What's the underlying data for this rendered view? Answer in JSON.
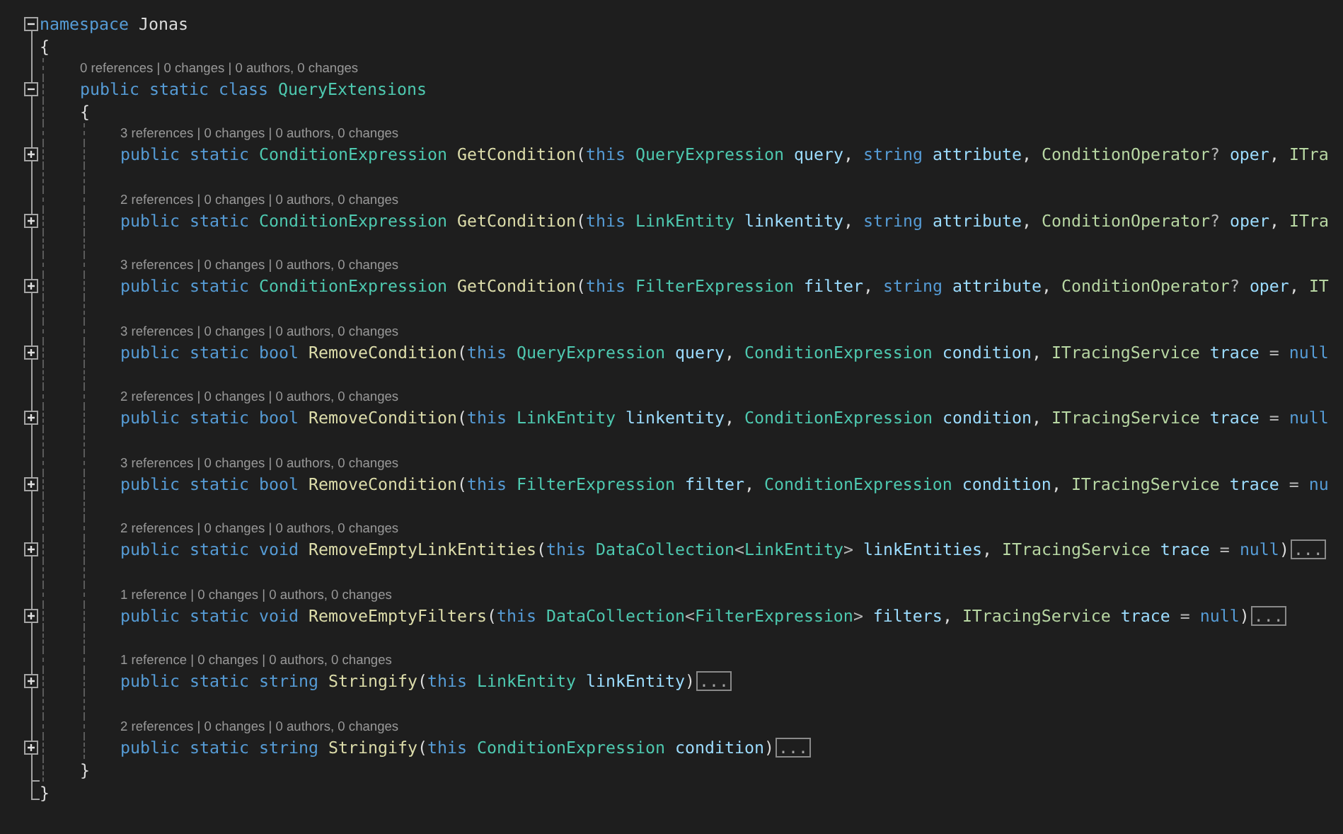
{
  "editor": {
    "namespace": {
      "tokens": [
        {
          "text": "namespace ",
          "kind": "kw"
        },
        {
          "text": "Jonas",
          "kind": "plain"
        }
      ],
      "expanded": true,
      "open_brace": "{",
      "close_brace": "}",
      "classes": [
        {
          "lens": "0 references | 0 changes | 0 authors, 0 changes",
          "tokens": [
            {
              "text": "public static class ",
              "kind": "kw"
            },
            {
              "text": "QueryExtensions",
              "kind": "type"
            }
          ],
          "expanded": true,
          "open_brace": "{",
          "close_brace": "}",
          "members": [
            {
              "lens": "3 references | 0 changes | 0 authors, 0 changes",
              "expanded": false,
              "tokens": [
                {
                  "text": "public static ",
                  "kind": "kw"
                },
                {
                  "text": "ConditionExpression ",
                  "kind": "type"
                },
                {
                  "text": "GetCondition",
                  "kind": "method"
                },
                {
                  "text": "(",
                  "kind": "plain"
                },
                {
                  "text": "this ",
                  "kind": "kw"
                },
                {
                  "text": "QueryExpression",
                  "kind": "type"
                },
                {
                  "text": " query",
                  "kind": "param"
                },
                {
                  "text": ", ",
                  "kind": "plain"
                },
                {
                  "text": "string ",
                  "kind": "kw"
                },
                {
                  "text": "attribute",
                  "kind": "param"
                },
                {
                  "text": ", ",
                  "kind": "plain"
                },
                {
                  "text": "ConditionOperator",
                  "kind": "iface"
                },
                {
                  "text": "? ",
                  "kind": "op"
                },
                {
                  "text": "oper",
                  "kind": "param"
                },
                {
                  "text": ", ",
                  "kind": "plain"
                },
                {
                  "text": "ITra",
                  "kind": "iface"
                }
              ]
            },
            {
              "lens": "2 references | 0 changes | 0 authors, 0 changes",
              "expanded": false,
              "tokens": [
                {
                  "text": "public static ",
                  "kind": "kw"
                },
                {
                  "text": "ConditionExpression ",
                  "kind": "type"
                },
                {
                  "text": "GetCondition",
                  "kind": "method"
                },
                {
                  "text": "(",
                  "kind": "plain"
                },
                {
                  "text": "this ",
                  "kind": "kw"
                },
                {
                  "text": "LinkEntity",
                  "kind": "type"
                },
                {
                  "text": " linkentity",
                  "kind": "param"
                },
                {
                  "text": ", ",
                  "kind": "plain"
                },
                {
                  "text": "string ",
                  "kind": "kw"
                },
                {
                  "text": "attribute",
                  "kind": "param"
                },
                {
                  "text": ", ",
                  "kind": "plain"
                },
                {
                  "text": "ConditionOperator",
                  "kind": "iface"
                },
                {
                  "text": "? ",
                  "kind": "op"
                },
                {
                  "text": "oper",
                  "kind": "param"
                },
                {
                  "text": ", ",
                  "kind": "plain"
                },
                {
                  "text": "ITra",
                  "kind": "iface"
                }
              ]
            },
            {
              "lens": "3 references | 0 changes | 0 authors, 0 changes",
              "expanded": false,
              "tokens": [
                {
                  "text": "public static ",
                  "kind": "kw"
                },
                {
                  "text": "ConditionExpression ",
                  "kind": "type"
                },
                {
                  "text": "GetCondition",
                  "kind": "method"
                },
                {
                  "text": "(",
                  "kind": "plain"
                },
                {
                  "text": "this ",
                  "kind": "kw"
                },
                {
                  "text": "FilterExpression",
                  "kind": "type"
                },
                {
                  "text": " filter",
                  "kind": "param"
                },
                {
                  "text": ", ",
                  "kind": "plain"
                },
                {
                  "text": "string ",
                  "kind": "kw"
                },
                {
                  "text": "attribute",
                  "kind": "param"
                },
                {
                  "text": ", ",
                  "kind": "plain"
                },
                {
                  "text": "ConditionOperator",
                  "kind": "iface"
                },
                {
                  "text": "? ",
                  "kind": "op"
                },
                {
                  "text": "oper",
                  "kind": "param"
                },
                {
                  "text": ", ",
                  "kind": "plain"
                },
                {
                  "text": "IT",
                  "kind": "iface"
                }
              ]
            },
            {
              "lens": "3 references | 0 changes | 0 authors, 0 changes",
              "expanded": false,
              "tokens": [
                {
                  "text": "public static bool ",
                  "kind": "kw"
                },
                {
                  "text": "RemoveCondition",
                  "kind": "method"
                },
                {
                  "text": "(",
                  "kind": "plain"
                },
                {
                  "text": "this ",
                  "kind": "kw"
                },
                {
                  "text": "QueryExpression",
                  "kind": "type"
                },
                {
                  "text": " query",
                  "kind": "param"
                },
                {
                  "text": ", ",
                  "kind": "plain"
                },
                {
                  "text": "ConditionExpression",
                  "kind": "type"
                },
                {
                  "text": " condition",
                  "kind": "param"
                },
                {
                  "text": ", ",
                  "kind": "plain"
                },
                {
                  "text": "ITracingService",
                  "kind": "iface"
                },
                {
                  "text": " trace",
                  "kind": "param"
                },
                {
                  "text": " = ",
                  "kind": "op"
                },
                {
                  "text": "null",
                  "kind": "kw"
                }
              ]
            },
            {
              "lens": "2 references | 0 changes | 0 authors, 0 changes",
              "expanded": false,
              "tokens": [
                {
                  "text": "public static bool ",
                  "kind": "kw"
                },
                {
                  "text": "RemoveCondition",
                  "kind": "method"
                },
                {
                  "text": "(",
                  "kind": "plain"
                },
                {
                  "text": "this ",
                  "kind": "kw"
                },
                {
                  "text": "LinkEntity",
                  "kind": "type"
                },
                {
                  "text": " linkentity",
                  "kind": "param"
                },
                {
                  "text": ", ",
                  "kind": "plain"
                },
                {
                  "text": "ConditionExpression",
                  "kind": "type"
                },
                {
                  "text": " condition",
                  "kind": "param"
                },
                {
                  "text": ", ",
                  "kind": "plain"
                },
                {
                  "text": "ITracingService",
                  "kind": "iface"
                },
                {
                  "text": " trace",
                  "kind": "param"
                },
                {
                  "text": " = ",
                  "kind": "op"
                },
                {
                  "text": "null",
                  "kind": "kw"
                }
              ]
            },
            {
              "lens": "3 references | 0 changes | 0 authors, 0 changes",
              "expanded": false,
              "tokens": [
                {
                  "text": "public static bool ",
                  "kind": "kw"
                },
                {
                  "text": "RemoveCondition",
                  "kind": "method"
                },
                {
                  "text": "(",
                  "kind": "plain"
                },
                {
                  "text": "this ",
                  "kind": "kw"
                },
                {
                  "text": "FilterExpression",
                  "kind": "type"
                },
                {
                  "text": " filter",
                  "kind": "param"
                },
                {
                  "text": ", ",
                  "kind": "plain"
                },
                {
                  "text": "ConditionExpression",
                  "kind": "type"
                },
                {
                  "text": " condition",
                  "kind": "param"
                },
                {
                  "text": ", ",
                  "kind": "plain"
                },
                {
                  "text": "ITracingService",
                  "kind": "iface"
                },
                {
                  "text": " trace",
                  "kind": "param"
                },
                {
                  "text": " = ",
                  "kind": "op"
                },
                {
                  "text": "nu",
                  "kind": "kw"
                }
              ]
            },
            {
              "lens": "2 references | 0 changes | 0 authors, 0 changes",
              "expanded": false,
              "collapsed_hint": "...",
              "tokens": [
                {
                  "text": "public static void ",
                  "kind": "kw"
                },
                {
                  "text": "RemoveEmptyLinkEntities",
                  "kind": "method"
                },
                {
                  "text": "(",
                  "kind": "plain"
                },
                {
                  "text": "this ",
                  "kind": "kw"
                },
                {
                  "text": "DataCollection",
                  "kind": "type"
                },
                {
                  "text": "<",
                  "kind": "op"
                },
                {
                  "text": "LinkEntity",
                  "kind": "type"
                },
                {
                  "text": ">",
                  "kind": "op"
                },
                {
                  "text": " linkEntities",
                  "kind": "param"
                },
                {
                  "text": ", ",
                  "kind": "plain"
                },
                {
                  "text": "ITracingService",
                  "kind": "iface"
                },
                {
                  "text": " trace",
                  "kind": "param"
                },
                {
                  "text": " = ",
                  "kind": "op"
                },
                {
                  "text": "null",
                  "kind": "kw"
                },
                {
                  "text": ")",
                  "kind": "plain"
                }
              ]
            },
            {
              "lens": "1 reference | 0 changes | 0 authors, 0 changes",
              "expanded": false,
              "collapsed_hint": "...",
              "tokens": [
                {
                  "text": "public static void ",
                  "kind": "kw"
                },
                {
                  "text": "RemoveEmptyFilters",
                  "kind": "method"
                },
                {
                  "text": "(",
                  "kind": "plain"
                },
                {
                  "text": "this ",
                  "kind": "kw"
                },
                {
                  "text": "DataCollection",
                  "kind": "type"
                },
                {
                  "text": "<",
                  "kind": "op"
                },
                {
                  "text": "FilterExpression",
                  "kind": "type"
                },
                {
                  "text": ">",
                  "kind": "op"
                },
                {
                  "text": " filters",
                  "kind": "param"
                },
                {
                  "text": ", ",
                  "kind": "plain"
                },
                {
                  "text": "ITracingService",
                  "kind": "iface"
                },
                {
                  "text": " trace",
                  "kind": "param"
                },
                {
                  "text": " = ",
                  "kind": "op"
                },
                {
                  "text": "null",
                  "kind": "kw"
                },
                {
                  "text": ")",
                  "kind": "plain"
                }
              ]
            },
            {
              "lens": "1 reference | 0 changes | 0 authors, 0 changes",
              "expanded": false,
              "collapsed_hint": "...",
              "tokens": [
                {
                  "text": "public static string ",
                  "kind": "kw"
                },
                {
                  "text": "Stringify",
                  "kind": "method"
                },
                {
                  "text": "(",
                  "kind": "plain"
                },
                {
                  "text": "this ",
                  "kind": "kw"
                },
                {
                  "text": "LinkEntity",
                  "kind": "type"
                },
                {
                  "text": " linkEntity",
                  "kind": "param"
                },
                {
                  "text": ")",
                  "kind": "plain"
                }
              ]
            },
            {
              "lens": "2 references | 0 changes | 0 authors, 0 changes",
              "expanded": false,
              "collapsed_hint": "...",
              "tokens": [
                {
                  "text": "public static string ",
                  "kind": "kw"
                },
                {
                  "text": "Stringify",
                  "kind": "method"
                },
                {
                  "text": "(",
                  "kind": "plain"
                },
                {
                  "text": "this ",
                  "kind": "kw"
                },
                {
                  "text": "ConditionExpression",
                  "kind": "type"
                },
                {
                  "text": " condition",
                  "kind": "param"
                },
                {
                  "text": ")",
                  "kind": "plain"
                }
              ]
            }
          ]
        }
      ]
    }
  }
}
